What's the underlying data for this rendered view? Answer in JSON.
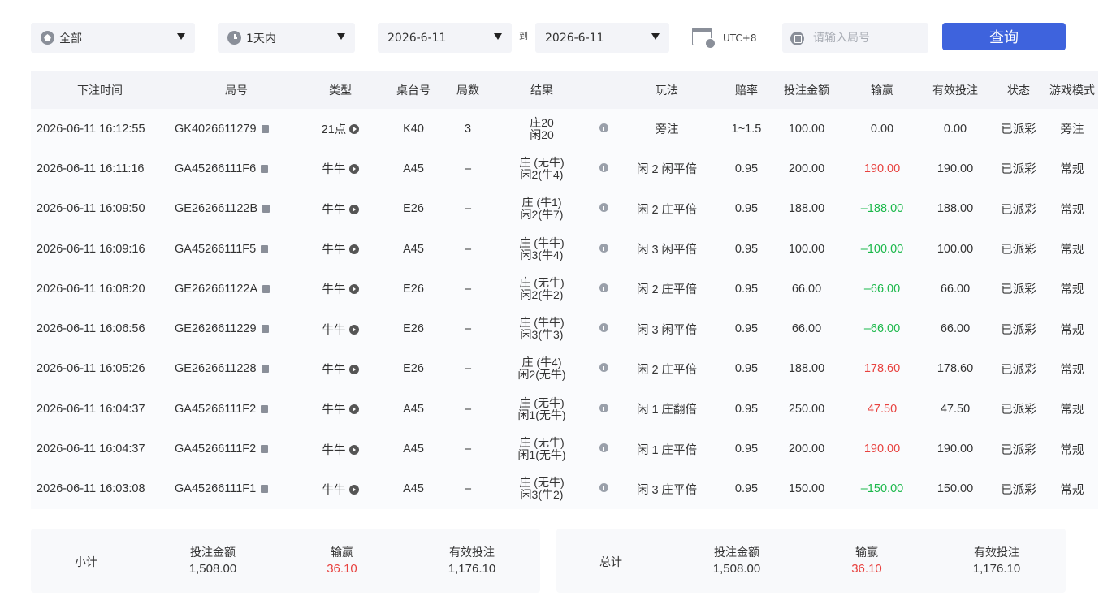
{
  "filters": {
    "category": "全部",
    "period": "1天内",
    "date_from": "2026-6-11",
    "to_label": "到",
    "date_to": "2026-6-11",
    "timezone": "UTC+8",
    "search_placeholder": "请输入局号",
    "query_label": "查询"
  },
  "table": {
    "headers": [
      "下注时间",
      "局号",
      "类型",
      "桌台号",
      "局数",
      "结果",
      "",
      "玩法",
      "赔率",
      "投注金额",
      "输赢",
      "有效投注",
      "状态",
      "游戏模式"
    ],
    "rows": [
      {
        "time": "2026-06-11 16:12:55",
        "round_id": "GK4026611279",
        "type": "21点",
        "table": "K40",
        "count": "3",
        "result1": "庄20",
        "result2": "闲20",
        "play": "旁注",
        "odds": "1~1.5",
        "amount": "100.00",
        "winloss": "0.00",
        "winloss_sign": "zero",
        "valid": "0.00",
        "status": "已派彩",
        "mode": "旁注"
      },
      {
        "time": "2026-06-11 16:11:16",
        "round_id": "GA45266111F6",
        "type": "牛牛",
        "table": "A45",
        "count": "–",
        "result1": "庄 (无牛)",
        "result2": "闲2(牛4)",
        "play": "闲 2 闲平倍",
        "odds": "0.95",
        "amount": "200.00",
        "winloss": "190.00",
        "winloss_sign": "pos",
        "valid": "190.00",
        "status": "已派彩",
        "mode": "常规"
      },
      {
        "time": "2026-06-11 16:09:50",
        "round_id": "GE262661122B",
        "type": "牛牛",
        "table": "E26",
        "count": "–",
        "result1": "庄 (牛1)",
        "result2": "闲2(牛7)",
        "play": "闲 2 庄平倍",
        "odds": "0.95",
        "amount": "188.00",
        "winloss": "–188.00",
        "winloss_sign": "neg",
        "valid": "188.00",
        "status": "已派彩",
        "mode": "常规"
      },
      {
        "time": "2026-06-11 16:09:16",
        "round_id": "GA45266111F5",
        "type": "牛牛",
        "table": "A45",
        "count": "–",
        "result1": "庄 (牛牛)",
        "result2": "闲3(牛4)",
        "play": "闲 3 闲平倍",
        "odds": "0.95",
        "amount": "100.00",
        "winloss": "–100.00",
        "winloss_sign": "neg",
        "valid": "100.00",
        "status": "已派彩",
        "mode": "常规"
      },
      {
        "time": "2026-06-11 16:08:20",
        "round_id": "GE262661122A",
        "type": "牛牛",
        "table": "E26",
        "count": "–",
        "result1": "庄 (无牛)",
        "result2": "闲2(牛2)",
        "play": "闲 2 庄平倍",
        "odds": "0.95",
        "amount": "66.00",
        "winloss": "–66.00",
        "winloss_sign": "neg",
        "valid": "66.00",
        "status": "已派彩",
        "mode": "常规"
      },
      {
        "time": "2026-06-11 16:06:56",
        "round_id": "GE2626611229",
        "type": "牛牛",
        "table": "E26",
        "count": "–",
        "result1": "庄 (牛牛)",
        "result2": "闲3(牛3)",
        "play": "闲 3 闲平倍",
        "odds": "0.95",
        "amount": "66.00",
        "winloss": "–66.00",
        "winloss_sign": "neg",
        "valid": "66.00",
        "status": "已派彩",
        "mode": "常规"
      },
      {
        "time": "2026-06-11 16:05:26",
        "round_id": "GE2626611228",
        "type": "牛牛",
        "table": "E26",
        "count": "–",
        "result1": "庄 (牛4)",
        "result2": "闲2(无牛)",
        "play": "闲 2 庄平倍",
        "odds": "0.95",
        "amount": "188.00",
        "winloss": "178.60",
        "winloss_sign": "pos",
        "valid": "178.60",
        "status": "已派彩",
        "mode": "常规"
      },
      {
        "time": "2026-06-11 16:04:37",
        "round_id": "GA45266111F2",
        "type": "牛牛",
        "table": "A45",
        "count": "–",
        "result1": "庄 (无牛)",
        "result2": "闲1(无牛)",
        "play": "闲 1 庄翻倍",
        "odds": "0.95",
        "amount": "250.00",
        "winloss": "47.50",
        "winloss_sign": "pos",
        "valid": "47.50",
        "status": "已派彩",
        "mode": "常规"
      },
      {
        "time": "2026-06-11 16:04:37",
        "round_id": "GA45266111F2",
        "type": "牛牛",
        "table": "A45",
        "count": "–",
        "result1": "庄 (无牛)",
        "result2": "闲1(无牛)",
        "play": "闲 1 庄平倍",
        "odds": "0.95",
        "amount": "200.00",
        "winloss": "190.00",
        "winloss_sign": "pos",
        "valid": "190.00",
        "status": "已派彩",
        "mode": "常规"
      },
      {
        "time": "2026-06-11 16:03:08",
        "round_id": "GA45266111F1",
        "type": "牛牛",
        "table": "A45",
        "count": "–",
        "result1": "庄 (无牛)",
        "result2": "闲3(牛2)",
        "play": "闲 3 庄平倍",
        "odds": "0.95",
        "amount": "150.00",
        "winloss": "–150.00",
        "winloss_sign": "neg",
        "valid": "150.00",
        "status": "已派彩",
        "mode": "常规"
      }
    ]
  },
  "subtotal": {
    "label": "小计",
    "amount_label": "投注金额",
    "amount": "1,508.00",
    "winloss_label": "输赢",
    "winloss": "36.10",
    "valid_label": "有效投注",
    "valid": "1,176.10"
  },
  "total": {
    "label": "总计",
    "amount_label": "投注金额",
    "amount": "1,508.00",
    "winloss_label": "输赢",
    "winloss": "36.10",
    "valid_label": "有效投注",
    "valid": "1,176.10"
  },
  "colors": {
    "accent": "#3e63dd",
    "positive": "#e8423f",
    "negative": "#1bb84a"
  }
}
